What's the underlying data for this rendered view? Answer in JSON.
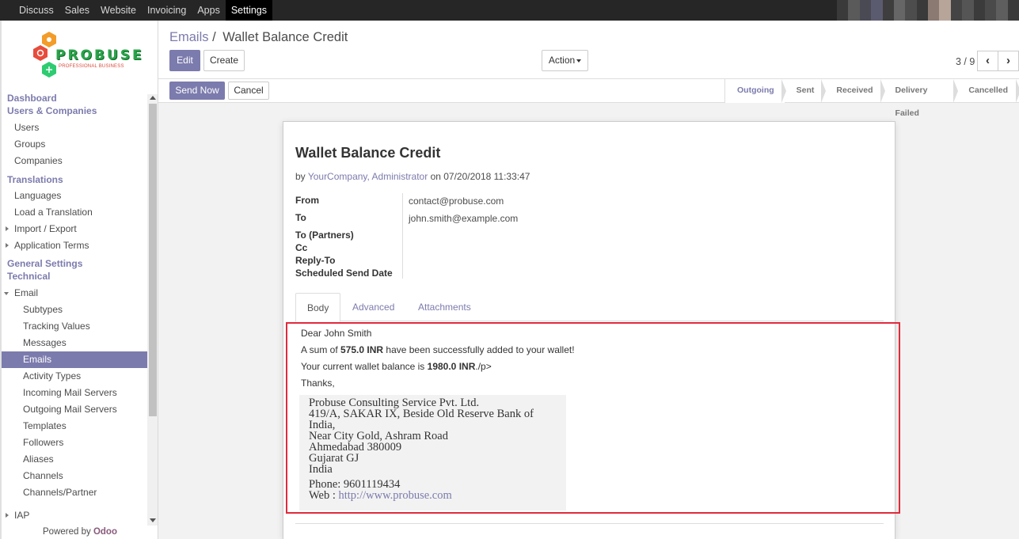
{
  "topnav": {
    "items": [
      "Discuss",
      "Sales",
      "Website",
      "Invoicing",
      "Apps",
      "Settings"
    ],
    "active": "Settings"
  },
  "logo": {
    "brand": "PROBUSE",
    "tagline": "PROFESSIONAL BUSINESS"
  },
  "sidebar": {
    "dashboard": "Dashboard",
    "users_companies": "Users & Companies",
    "users": "Users",
    "groups": "Groups",
    "companies": "Companies",
    "translations": "Translations",
    "languages": "Languages",
    "load_translation": "Load a Translation",
    "import_export": "Import / Export",
    "application_terms": "Application Terms",
    "general_settings": "General Settings",
    "technical": "Technical",
    "email": "Email",
    "subtypes": "Subtypes",
    "tracking_values": "Tracking Values",
    "messages": "Messages",
    "emails": "Emails",
    "activity_types": "Activity Types",
    "incoming_mail": "Incoming Mail Servers",
    "outgoing_mail": "Outgoing Mail Servers",
    "templates": "Templates",
    "followers": "Followers",
    "aliases": "Aliases",
    "channels": "Channels",
    "channels_partner": "Channels/Partner",
    "iap": "IAP",
    "powered_by": "Powered by",
    "powered_brand": "Odoo"
  },
  "control": {
    "breadcrumb_parent": "Emails",
    "breadcrumb_sep": "/",
    "breadcrumb_current": "Wallet Balance Credit",
    "edit": "Edit",
    "create": "Create",
    "action": "Action",
    "pager": "3 / 9",
    "prev": "‹",
    "next": "›"
  },
  "statusbar": {
    "send_now": "Send Now",
    "cancel": "Cancel",
    "stages": [
      "Outgoing",
      "Sent",
      "Received",
      "Delivery Failed",
      "Cancelled"
    ],
    "current": "Outgoing"
  },
  "email": {
    "subject": "Wallet Balance Credit",
    "by": "by",
    "author": "YourCompany, Administrator",
    "on": "on 07/20/2018 11:33:47",
    "fields": {
      "from_label": "From",
      "from_value": "contact@probuse.com",
      "to_label": "To",
      "to_value": "john.smith@example.com",
      "to_partners_label": "To (Partners)",
      "cc_label": "Cc",
      "reply_to_label": "Reply-To",
      "scheduled_label": "Scheduled Send Date"
    },
    "tabs": [
      "Body",
      "Advanced",
      "Attachments"
    ],
    "active_tab": "Body",
    "body": {
      "greeting": "Dear John Smith",
      "sum_prefix": "A sum of ",
      "sum_amount": "575.0 INR",
      "sum_suffix": " have been successfully added to your wallet!",
      "balance_prefix": "Your current wallet balance is ",
      "balance_amount": "1980.0 INR",
      "balance_suffix": "./p>",
      "thanks": "Thanks,"
    },
    "signature": {
      "company": "Probuse Consulting Service Pvt. Ltd.",
      "addr1": "419/A, SAKAR IX, Beside Old Reserve Bank of",
      "addr2": "India,",
      "addr3": "Near City Gold, Ashram Road",
      "addr4": "Ahmedabad 380009",
      "addr5": "Gujarat GJ",
      "addr6": "India",
      "phone": "Phone:  9601119434",
      "web_label": "Web : ",
      "web_url": "http://www.probuse.com"
    }
  },
  "colors": {
    "accent": "#7c7bad",
    "highlight_border": "#e02b3c",
    "topbar": "#262626"
  }
}
